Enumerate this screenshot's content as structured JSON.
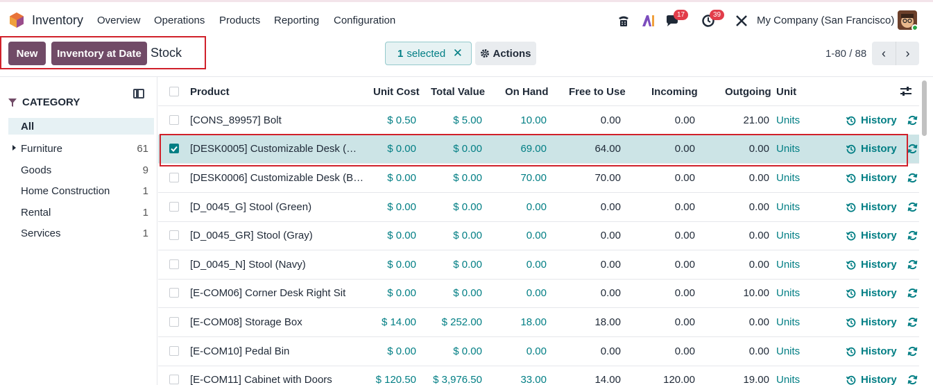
{
  "nav": {
    "app_name": "Inventory",
    "menu": [
      "Overview",
      "Operations",
      "Products",
      "Reporting",
      "Configuration"
    ],
    "messages_count": "17",
    "activities_count": "39",
    "company": "My Company (San Francisco)"
  },
  "control": {
    "new_label": "New",
    "inventory_at_date_label": "Inventory at Date",
    "breadcrumb": "Stock",
    "selected_count": "1",
    "selected_text": "selected",
    "actions_label": "Actions",
    "pager": "1-80 / 88"
  },
  "sidebar": {
    "title": "CATEGORY",
    "items": [
      {
        "label": "All",
        "count": ""
      },
      {
        "label": "Furniture",
        "count": "61"
      },
      {
        "label": "Goods",
        "count": "9"
      },
      {
        "label": "Home Construction",
        "count": "1"
      },
      {
        "label": "Rental",
        "count": "1"
      },
      {
        "label": "Services",
        "count": "1"
      }
    ]
  },
  "table": {
    "headers": {
      "product": "Product",
      "unit_cost": "Unit Cost",
      "total_value": "Total Value",
      "on_hand": "On Hand",
      "free_to_use": "Free to Use",
      "incoming": "Incoming",
      "outgoing": "Outgoing",
      "unit": "Unit"
    },
    "history_label": "History",
    "rows": [
      {
        "product": "[CONS_89957] Bolt",
        "unit_cost": "$ 0.50",
        "total_value": "$ 5.00",
        "on_hand": "10.00",
        "free": "0.00",
        "incoming": "0.00",
        "outgoing": "21.00",
        "unit": "Units",
        "selected": false
      },
      {
        "product": "[DESK0005] Customizable Desk (…",
        "unit_cost": "$ 0.00",
        "total_value": "$ 0.00",
        "on_hand": "69.00",
        "free": "64.00",
        "incoming": "0.00",
        "outgoing": "0.00",
        "unit": "Units",
        "selected": true
      },
      {
        "product": "[DESK0006] Customizable Desk (B…",
        "unit_cost": "$ 0.00",
        "total_value": "$ 0.00",
        "on_hand": "70.00",
        "free": "70.00",
        "incoming": "0.00",
        "outgoing": "0.00",
        "unit": "Units",
        "selected": false
      },
      {
        "product": "[D_0045_G] Stool (Green)",
        "unit_cost": "$ 0.00",
        "total_value": "$ 0.00",
        "on_hand": "0.00",
        "free": "0.00",
        "incoming": "0.00",
        "outgoing": "0.00",
        "unit": "Units",
        "selected": false
      },
      {
        "product": "[D_0045_GR] Stool (Gray)",
        "unit_cost": "$ 0.00",
        "total_value": "$ 0.00",
        "on_hand": "0.00",
        "free": "0.00",
        "incoming": "0.00",
        "outgoing": "0.00",
        "unit": "Units",
        "selected": false
      },
      {
        "product": "[D_0045_N] Stool (Navy)",
        "unit_cost": "$ 0.00",
        "total_value": "$ 0.00",
        "on_hand": "0.00",
        "free": "0.00",
        "incoming": "0.00",
        "outgoing": "0.00",
        "unit": "Units",
        "selected": false
      },
      {
        "product": "[E-COM06] Corner Desk Right Sit",
        "unit_cost": "$ 0.00",
        "total_value": "$ 0.00",
        "on_hand": "0.00",
        "free": "0.00",
        "incoming": "0.00",
        "outgoing": "10.00",
        "unit": "Units",
        "selected": false
      },
      {
        "product": "[E-COM08] Storage Box",
        "unit_cost": "$ 14.00",
        "total_value": "$ 252.00",
        "on_hand": "18.00",
        "free": "18.00",
        "incoming": "0.00",
        "outgoing": "0.00",
        "unit": "Units",
        "selected": false
      },
      {
        "product": "[E-COM10] Pedal Bin",
        "unit_cost": "$ 0.00",
        "total_value": "$ 0.00",
        "on_hand": "0.00",
        "free": "0.00",
        "incoming": "0.00",
        "outgoing": "0.00",
        "unit": "Units",
        "selected": false
      },
      {
        "product": "[E-COM11] Cabinet with Doors",
        "unit_cost": "$ 120.50",
        "total_value": "$ 3,976.50",
        "on_hand": "33.00",
        "free": "14.00",
        "incoming": "120.00",
        "outgoing": "19.00",
        "unit": "Units",
        "selected": false
      }
    ]
  },
  "colors": {
    "brand": "#714b67",
    "accent": "#017e84",
    "highlight_box": "#d0202a"
  }
}
